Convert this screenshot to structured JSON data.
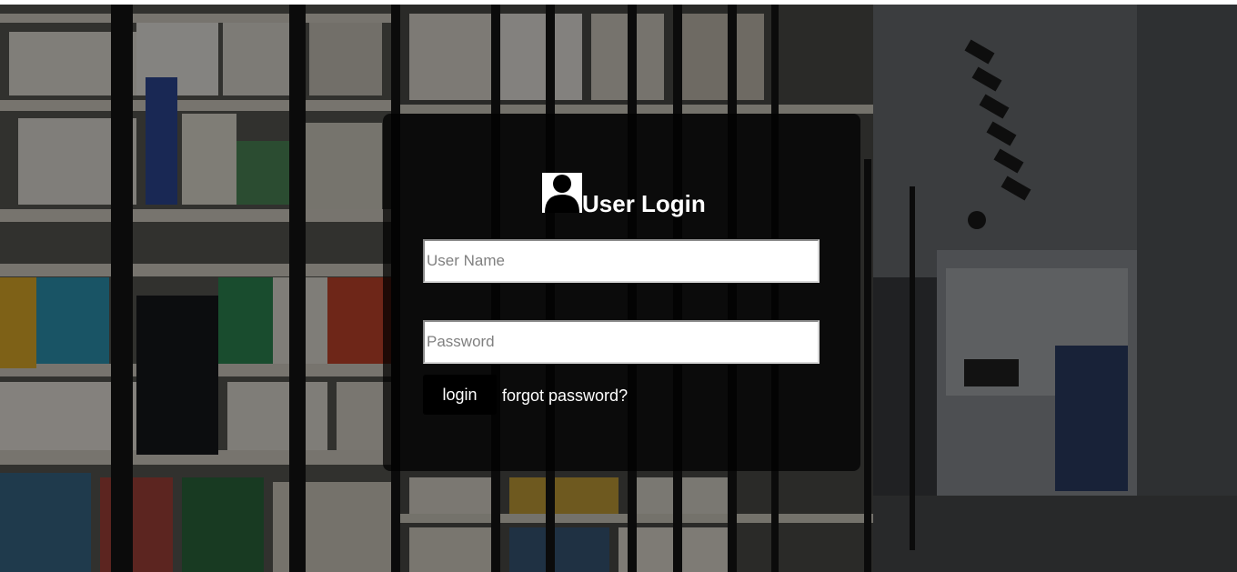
{
  "login_form": {
    "title": "User Login",
    "icon": "user-icon",
    "username_placeholder": "User Name",
    "username_value": "",
    "password_placeholder": "Password",
    "password_value": "",
    "login_label": "login",
    "forgot_label": "forgot password?"
  },
  "background": {
    "description_icon": "library-bookshelves-image"
  },
  "colors": {
    "card_bg": "#000000",
    "text": "#ffffff",
    "button_bg": "#000000"
  }
}
